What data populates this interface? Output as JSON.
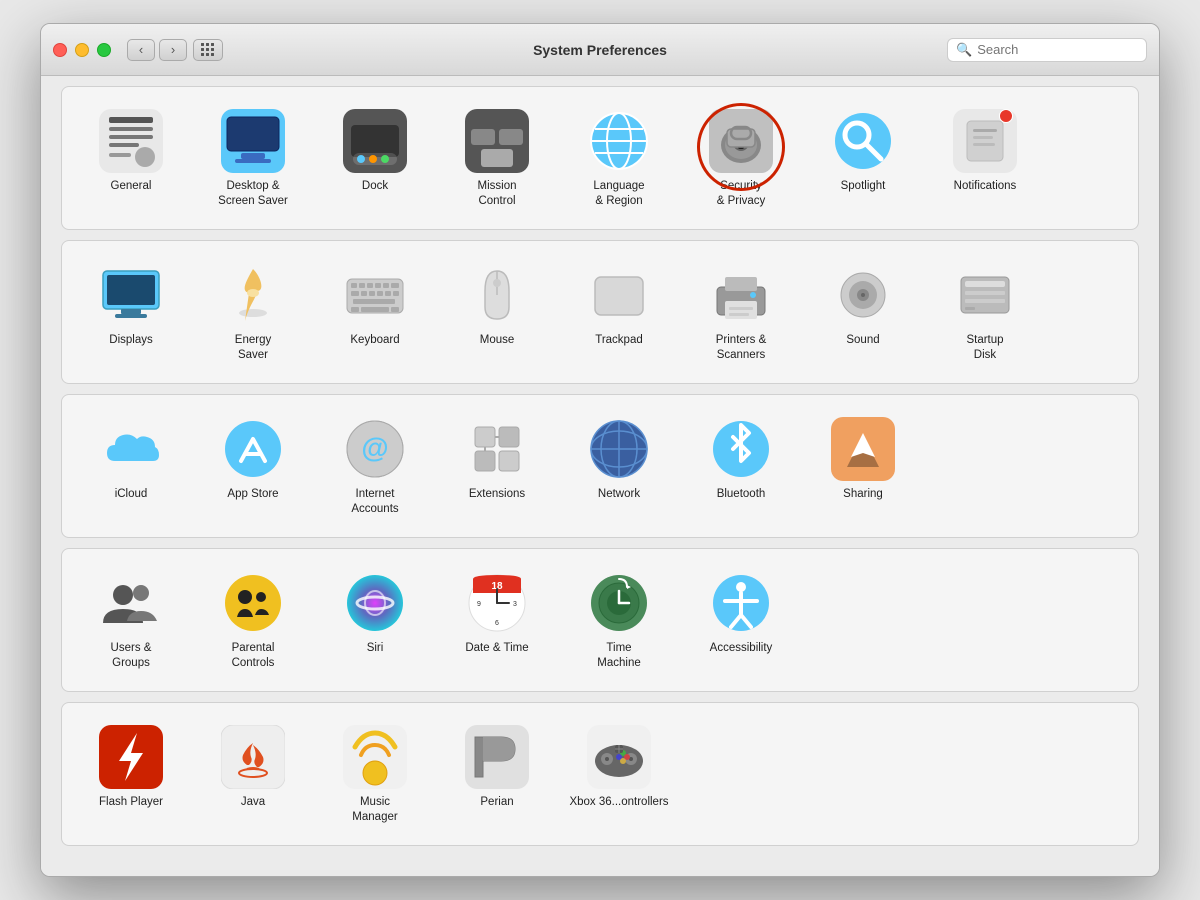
{
  "window": {
    "title": "System Preferences",
    "search_placeholder": "Search"
  },
  "titlebar": {
    "back_label": "‹",
    "forward_label": "›"
  },
  "sections": [
    {
      "id": "personal",
      "items": [
        {
          "id": "general",
          "label": "General",
          "icon": "general"
        },
        {
          "id": "desktop-screensaver",
          "label": "Desktop &\nScreen Saver",
          "icon": "desktop"
        },
        {
          "id": "dock",
          "label": "Dock",
          "icon": "dock"
        },
        {
          "id": "mission-control",
          "label": "Mission\nControl",
          "icon": "mission"
        },
        {
          "id": "language-region",
          "label": "Language\n& Region",
          "icon": "language"
        },
        {
          "id": "security-privacy",
          "label": "Security\n& Privacy",
          "icon": "security",
          "highlighted": true
        },
        {
          "id": "spotlight",
          "label": "Spotlight",
          "icon": "spotlight"
        },
        {
          "id": "notifications",
          "label": "Notifications",
          "icon": "notifications",
          "badge": true
        }
      ]
    },
    {
      "id": "hardware",
      "items": [
        {
          "id": "displays",
          "label": "Displays",
          "icon": "displays"
        },
        {
          "id": "energy-saver",
          "label": "Energy\nSaver",
          "icon": "energy"
        },
        {
          "id": "keyboard",
          "label": "Keyboard",
          "icon": "keyboard"
        },
        {
          "id": "mouse",
          "label": "Mouse",
          "icon": "mouse"
        },
        {
          "id": "trackpad",
          "label": "Trackpad",
          "icon": "trackpad"
        },
        {
          "id": "printers-scanners",
          "label": "Printers &\nScanners",
          "icon": "printers"
        },
        {
          "id": "sound",
          "label": "Sound",
          "icon": "sound"
        },
        {
          "id": "startup-disk",
          "label": "Startup\nDisk",
          "icon": "startup"
        }
      ]
    },
    {
      "id": "internet",
      "items": [
        {
          "id": "icloud",
          "label": "iCloud",
          "icon": "icloud"
        },
        {
          "id": "app-store",
          "label": "App Store",
          "icon": "appstore"
        },
        {
          "id": "internet-accounts",
          "label": "Internet\nAccounts",
          "icon": "internet"
        },
        {
          "id": "extensions",
          "label": "Extensions",
          "icon": "extensions"
        },
        {
          "id": "network",
          "label": "Network",
          "icon": "network"
        },
        {
          "id": "bluetooth",
          "label": "Bluetooth",
          "icon": "bluetooth"
        },
        {
          "id": "sharing",
          "label": "Sharing",
          "icon": "sharing"
        }
      ]
    },
    {
      "id": "system",
      "items": [
        {
          "id": "users-groups",
          "label": "Users &\nGroups",
          "icon": "users"
        },
        {
          "id": "parental-controls",
          "label": "Parental\nControls",
          "icon": "parental"
        },
        {
          "id": "siri",
          "label": "Siri",
          "icon": "siri"
        },
        {
          "id": "date-time",
          "label": "Date & Time",
          "icon": "datetime"
        },
        {
          "id": "time-machine",
          "label": "Time\nMachine",
          "icon": "timemachine"
        },
        {
          "id": "accessibility",
          "label": "Accessibility",
          "icon": "accessibility"
        }
      ]
    },
    {
      "id": "other",
      "items": [
        {
          "id": "flash-player",
          "label": "Flash Player",
          "icon": "flash"
        },
        {
          "id": "java",
          "label": "Java",
          "icon": "java"
        },
        {
          "id": "music-manager",
          "label": "Music\nManager",
          "icon": "music"
        },
        {
          "id": "perian",
          "label": "Perian",
          "icon": "perian"
        },
        {
          "id": "xbox",
          "label": "Xbox 36...ontrollers",
          "icon": "xbox"
        }
      ]
    }
  ]
}
